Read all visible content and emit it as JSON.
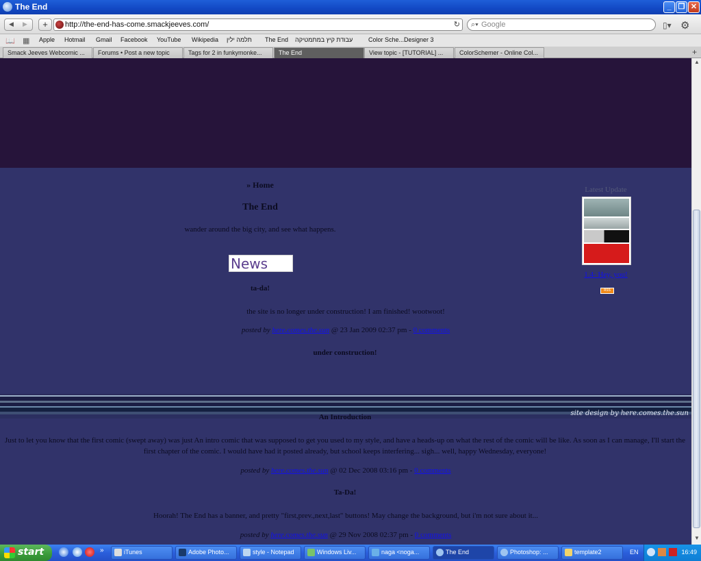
{
  "window": {
    "title": "The End"
  },
  "toolbar": {
    "url": "http://the-end-has-come.smackjeeves.com/",
    "search_placeholder": "Google"
  },
  "bookmarks": [
    "Apple",
    "Hotmail",
    "Gmail",
    "Facebook",
    "YouTube",
    "Wikipedia",
    "תלמה ילין",
    "The End",
    "עבודת קיץ במתמטיקה",
    "Color Sche...Designer 3"
  ],
  "tabs": [
    {
      "label": "Smack Jeeves Webcomic ...",
      "active": false
    },
    {
      "label": "Forums • Post a new topic",
      "active": false
    },
    {
      "label": "Tags for 2 in funkymonke...",
      "active": false
    },
    {
      "label": "The End",
      "active": true
    },
    {
      "label": "View topic - [TUTORIAL] ...",
      "active": false
    },
    {
      "label": "ColorSchemer - Online Col...",
      "active": false
    }
  ],
  "page": {
    "home_link": "» Home",
    "site_title": "The End",
    "tagline": "wander around the big city, and see what happens.",
    "news_heading": "News",
    "site_credit": "site design by here.comes.the.sun",
    "sidebar": {
      "label": "Latest Update",
      "update_link": "1.4- Hey, you!",
      "rss": "RSS"
    },
    "posts": [
      {
        "title": "ta-da!",
        "body": "the site is no longer under construction! I am finished! wootwoot!",
        "posted_by": "posted by",
        "author": "here.comes.the.sun",
        "date": "@ 23 Jan 2009 02:37 pm",
        "sep": "-",
        "comments": "0 comments"
      },
      {
        "title": "under construction!",
        "body": "",
        "posted_by": "",
        "author": "",
        "date": "",
        "sep": "",
        "comments": ""
      },
      {
        "title": "An Introduction",
        "body": "Just to let you know that the first comic (swept away) was just An intro comic that was supposed to get you used to my style, and have a heads-up on what the rest of the comic will be like. As soon as I can manage, I'll start the first chapter of the comic. I would have had it posted already, but school keeps interfering... sigh... well, happy Wednesday, everyone!",
        "posted_by": "posted by",
        "author": "here.comes.the.sun",
        "date": "@ 02 Dec 2008 03:16 pm",
        "sep": "-",
        "comments": "0 comments"
      },
      {
        "title": "Ta-Da!",
        "body": "Hoorah! The End has a banner, and pretty \"first,prev.,next,last\" buttons! May change the background, but i'm not sure about it...",
        "posted_by": "posted by",
        "author": "here.comes.the.sun",
        "date": "@ 29 Nov 2008 02:37 pm",
        "sep": "-",
        "comments": "0 comments"
      }
    ]
  },
  "taskbar": {
    "start": "start",
    "items": [
      {
        "label": "iTunes",
        "active": false
      },
      {
        "label": "Adobe Photo...",
        "active": false
      },
      {
        "label": "style - Notepad",
        "active": false
      },
      {
        "label": "Windows Liv...",
        "active": false
      },
      {
        "label": "naga <noga...",
        "active": false
      },
      {
        "label": "The End",
        "active": true
      },
      {
        "label": "Photoshop: ...",
        "active": false
      },
      {
        "label": "template2",
        "active": false
      }
    ],
    "lang": "EN",
    "clock": "16:49"
  }
}
